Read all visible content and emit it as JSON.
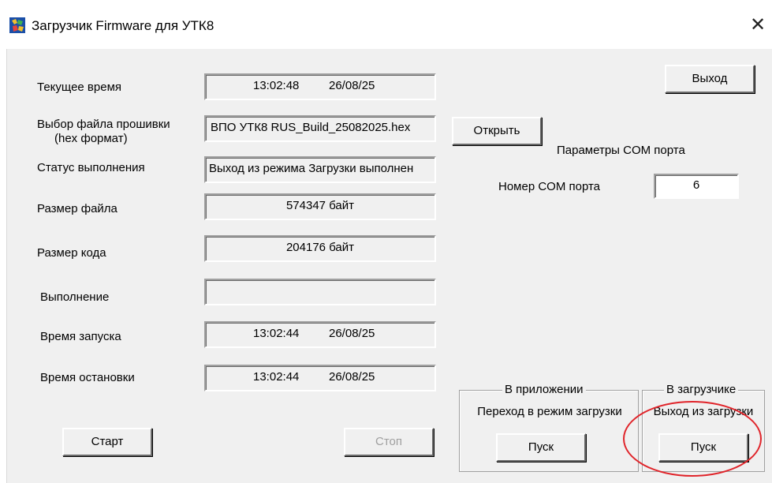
{
  "window": {
    "title": "Загрузчик Firmware для УТК8",
    "close_glyph": "✕",
    "icon": "app-icon"
  },
  "labels": {
    "current_time": "Текущее время",
    "file_select_line1": "Выбор файла прошивки",
    "file_select_line2": "(hex формат)",
    "status": "Статус выполнения",
    "file_size": "Размер файла",
    "code_size": "Размер кода",
    "execution": "Выполнение",
    "start_time": "Время запуска",
    "stop_time": "Время остановки",
    "com_params": "Параметры COM порта",
    "com_number": "Номер COM порта"
  },
  "fields": {
    "current_time_clock": "13:02:48",
    "current_time_date": "26/08/25",
    "file_name": "ВПО УТК8 RUS_Build_25082025.hex",
    "status_text": "Выход из режима Загрузки выполнен",
    "file_size": "574347 байт",
    "code_size": "204176 байт",
    "execution": "",
    "start_clock": "13:02:44",
    "start_date": "26/08/25",
    "stop_clock": "13:02:44",
    "stop_date": "26/08/25",
    "com_port": "6"
  },
  "buttons": {
    "exit": "Выход",
    "open": "Открыть",
    "start": "Старт",
    "stop": "Стоп"
  },
  "groups": {
    "in_app": {
      "legend": "В приложении",
      "caption": "Переход в режим загрузки",
      "button": "Пуск"
    },
    "in_loader": {
      "legend": "В загрузчике",
      "caption": "Выход из загрузки",
      "button": "Пуск"
    }
  },
  "colors": {
    "window_bg": "#f0f0f0",
    "highlight": "#e0242a"
  }
}
